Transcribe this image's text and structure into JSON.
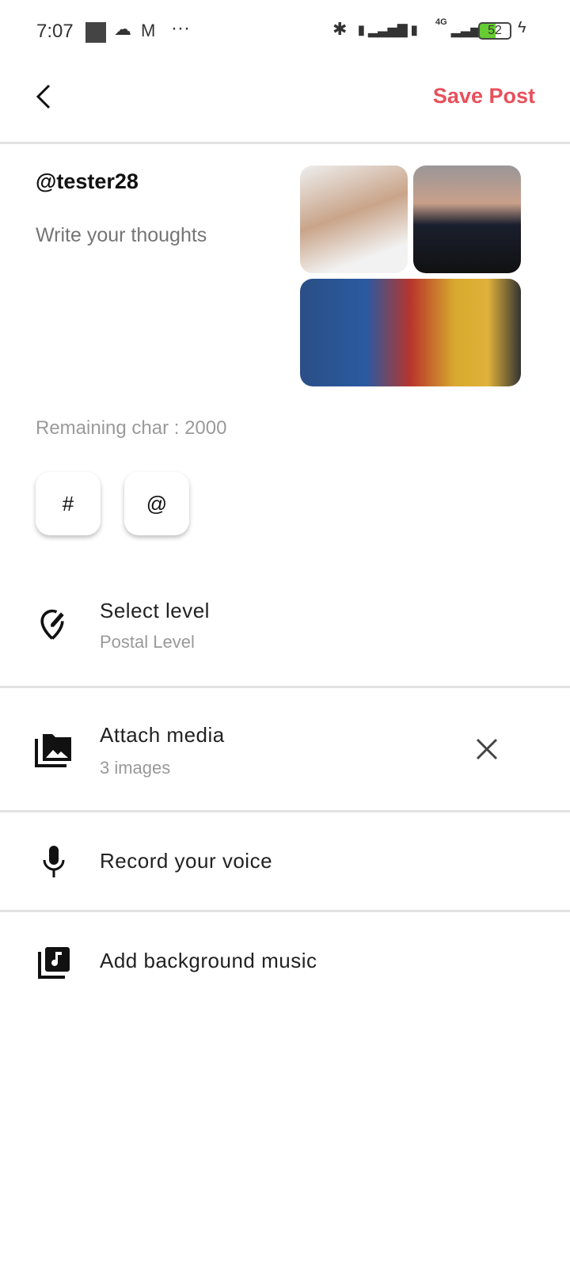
{
  "status": {
    "time": "7:07",
    "battery": "52",
    "network": "4G"
  },
  "header": {
    "save_label": "Save Post"
  },
  "post": {
    "username": "@tester28",
    "placeholder": "Write your thoughts",
    "remaining": "Remaining char : 2000"
  },
  "chips": {
    "hashtag": "#",
    "mention": "@"
  },
  "options": [
    {
      "title": "Select level",
      "subtitle": "Postal Level"
    },
    {
      "title": "Attach media",
      "subtitle": "3 images"
    },
    {
      "title": "Record your voice"
    },
    {
      "title": "Add background music"
    }
  ],
  "colors": {
    "accent": "#e8505b"
  }
}
